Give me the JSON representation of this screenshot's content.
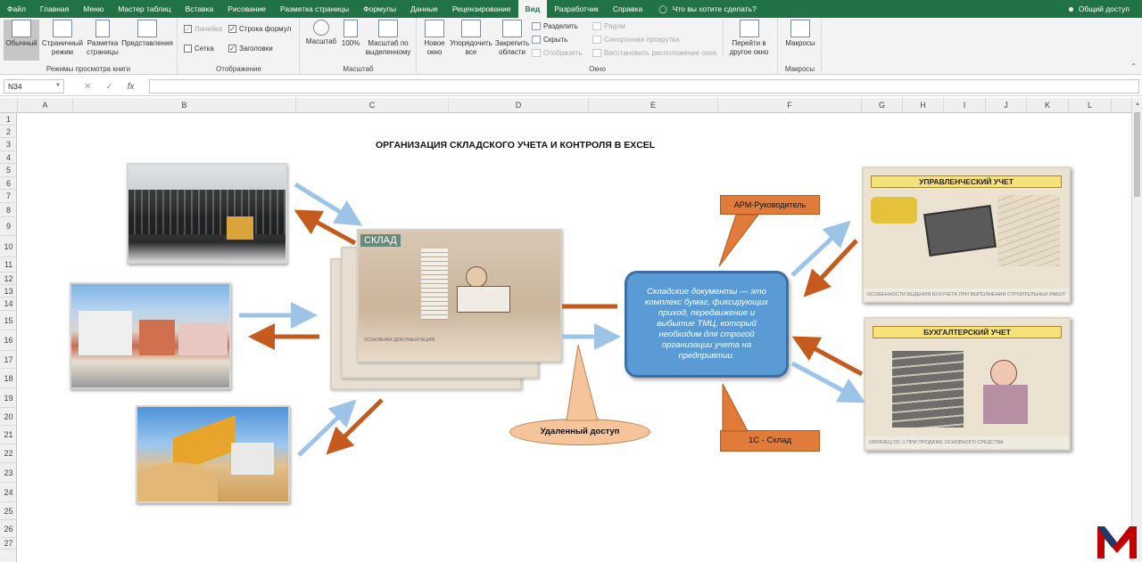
{
  "tabs": [
    "Файл",
    "Главная",
    "Меню",
    "Мастер таблиц",
    "Вставка",
    "Рисование",
    "Разметка страницы",
    "Формулы",
    "Данные",
    "Рецензирование",
    "Вид",
    "Разработчик",
    "Справка"
  ],
  "active_tab": "Вид",
  "tell_me": "Что вы хотите сделать?",
  "share": "Общий доступ",
  "ribbon": {
    "views": {
      "normal": "Обычный",
      "page_mode": "Страничный режим",
      "page_layout": "Разметка страницы",
      "custom": "Представления",
      "label": "Режимы просмотра книги"
    },
    "show": {
      "ruler": "Линейка",
      "grid": "Сетка",
      "formula_bar": "Строка формул",
      "headings": "Заголовки",
      "label": "Отображение"
    },
    "zoom": {
      "zoom": "Масштаб",
      "hundred": "100%",
      "to_selection": "Масштаб по выделенному",
      "label": "Масштаб"
    },
    "window": {
      "new_window": "Новое окно",
      "arrange": "Упорядочить все",
      "freeze": "Закрепить области",
      "split": "Разделить",
      "hide": "Скрыть",
      "unhide": "Отобразить",
      "side_by_side": "Рядом",
      "sync_scroll": "Синхронная прокрутка",
      "reset_pos": "Восстановить расположение окна",
      "switch": "Перейти в другое окно",
      "label": "Окно"
    },
    "macros": {
      "macros": "Макросы",
      "label": "Макросы"
    }
  },
  "formula_bar": {
    "name_box": "N34",
    "cancel": "✕",
    "enter": "✓",
    "fx": "fx",
    "formula": ""
  },
  "columns": [
    "A",
    "B",
    "C",
    "D",
    "E",
    "F",
    "G",
    "H",
    "I",
    "J",
    "K",
    "L"
  ],
  "rows": [
    "1",
    "2",
    "3",
    "4",
    "5",
    "6",
    "7",
    "8",
    "9",
    "10",
    "11",
    "12",
    "13",
    "14",
    "15",
    "16",
    "17",
    "18",
    "19",
    "20",
    "21",
    "22",
    "23",
    "24",
    "25",
    "26",
    "27"
  ],
  "sheet": {
    "title": "ОРГАНИЗАЦИЯ СКЛАДСКОГО УЧЕТА И КОНТРОЛЯ В EXCEL",
    "sklad_label": "СКЛАД",
    "sklad_caption": "ОСНОВНАЯ ДОКУМЕНТАЦИЯ",
    "center_text": "Складские документы — это комплекс бумаг, фиксирующих приход, передвижение и выбытие ТМЦ, который необходим для строгой организации учета на предприятии.",
    "arm": "АРМ-Руководитель",
    "onec": "1С - Склад",
    "remote": "Удаленный доступ",
    "mgmt_title": "УПРАВЛЕНЧЕСКИЙ УЧЕТ",
    "mgmt_caption": "ОСОБЕННОСТИ ВЕДЕНИЯ БУХУЧЕТА ПРИ ВЫПОЛНЕНИИ СТРОИТЕЛЬНЫХ РАБОТ",
    "acc_title": "БУХГАЛТЕРСКИЙ УЧЕТ",
    "acc_caption": "ОБРАЗЕЦ ОС-1 ПРИ ПРОДАЖЕ ОСНОВНОГО СРЕДСТВА"
  },
  "colors": {
    "excel_green": "#217346",
    "center_box": "#5b9bd5",
    "callout_orange": "#e07b39",
    "arrow_blue": "#9dc3e6",
    "arrow_brown": "#c55a1e",
    "logo_red": "#c00000"
  }
}
